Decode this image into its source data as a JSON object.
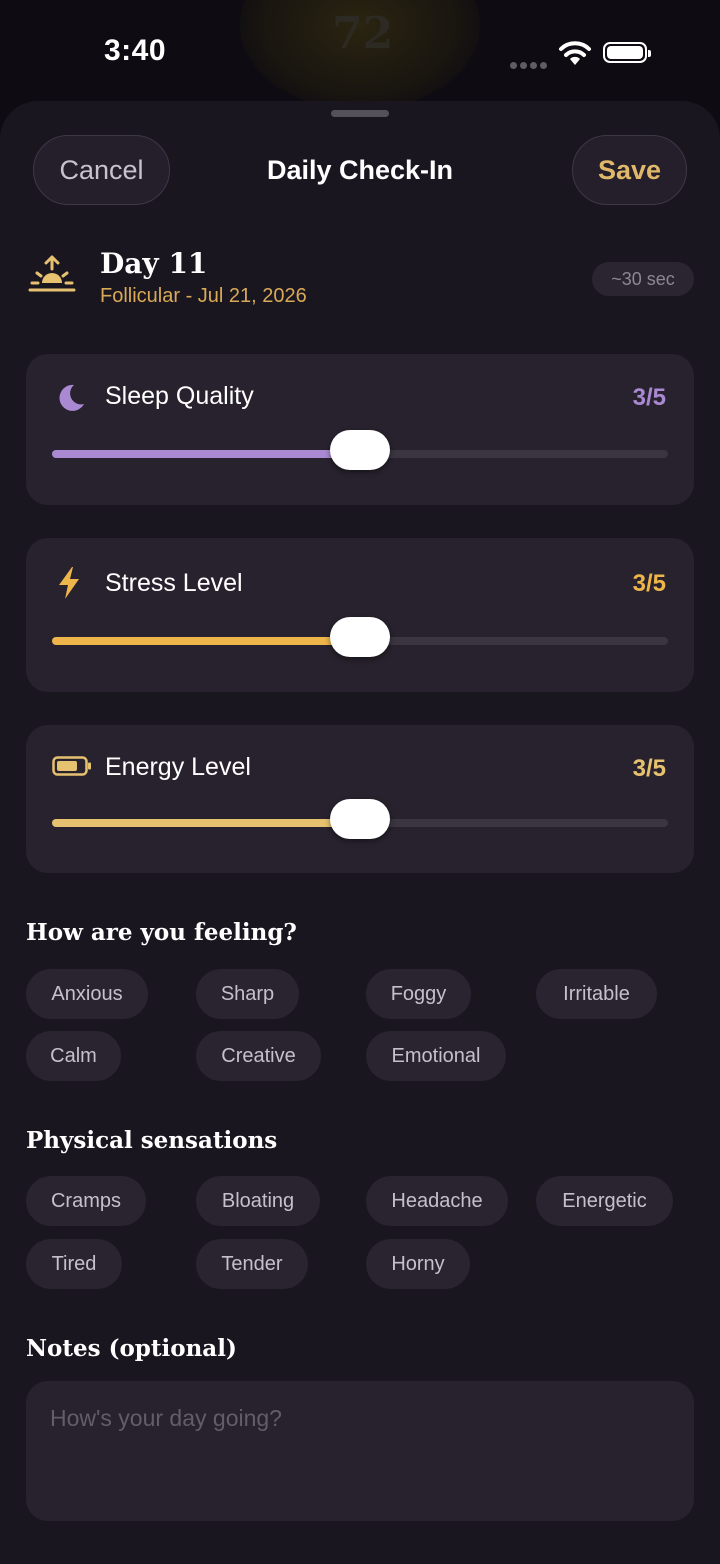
{
  "status_bar": {
    "time": "3:40"
  },
  "background": {
    "glow_number": "72"
  },
  "sheet": {
    "cancel_label": "Cancel",
    "title": "Daily Check-In",
    "save_label": "Save"
  },
  "day": {
    "title": "Day 11",
    "subtitle": "Follicular - Jul 21, 2026",
    "time_estimate": "~30 sec",
    "icon": "sunrise-icon"
  },
  "metrics": [
    {
      "label": "Sleep Quality",
      "value": "3/5",
      "level": 3,
      "max": 5,
      "icon": "moon-icon",
      "color": "#a989d2",
      "fill": 0.5
    },
    {
      "label": "Stress Level",
      "value": "3/5",
      "level": 3,
      "max": 5,
      "icon": "lightning-icon",
      "color": "#edb54a",
      "fill": 0.5
    },
    {
      "label": "Energy Level",
      "value": "3/5",
      "level": 3,
      "max": 5,
      "icon": "battery-icon",
      "color": "#e6c270",
      "fill": 0.5
    }
  ],
  "feelings": {
    "title": "How are you feeling?",
    "chips": [
      "Anxious",
      "Sharp",
      "Foggy",
      "Irritable",
      "Calm",
      "Creative",
      "Emotional"
    ]
  },
  "sensations": {
    "title": "Physical sensations",
    "chips": [
      "Cramps",
      "Bloating",
      "Headache",
      "Energetic",
      "Tired",
      "Tender",
      "Horny"
    ]
  },
  "notes": {
    "title": "Notes (optional)",
    "placeholder": "How's your day going?",
    "value": ""
  },
  "colors": {
    "accent_gold": "#e1b86a",
    "sleep_purple": "#a989d2",
    "stress_orange": "#edb54a",
    "energy_gold": "#e6c270",
    "sheet_bg": "#1a1620",
    "card_bg": "#27222d"
  }
}
